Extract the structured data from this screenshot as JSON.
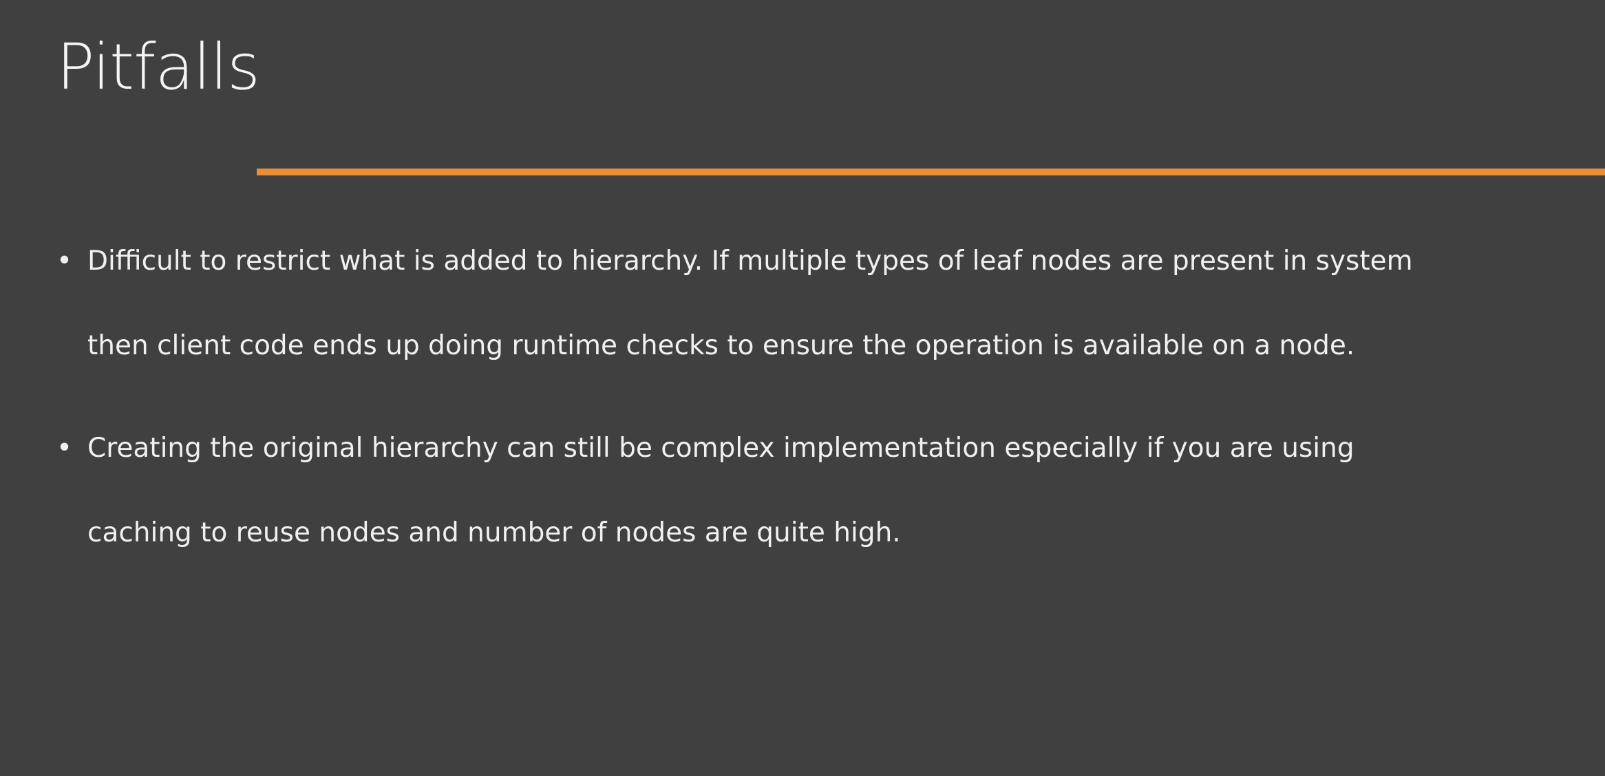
{
  "slide": {
    "title": "Pitfalls",
    "accent_color": "#e98d36",
    "background_color": "#404040",
    "bullets": [
      {
        "lines": [
          "Difficult to restrict what is added to hierarchy. If multiple types of leaf nodes are present in system",
          "then client code ends up doing runtime checks to ensure the operation is available on a node."
        ]
      },
      {
        "lines": [
          "Creating the original hierarchy can still be complex implementation especially if you are using",
          "caching to reuse nodes and number of nodes are quite high."
        ]
      }
    ]
  }
}
